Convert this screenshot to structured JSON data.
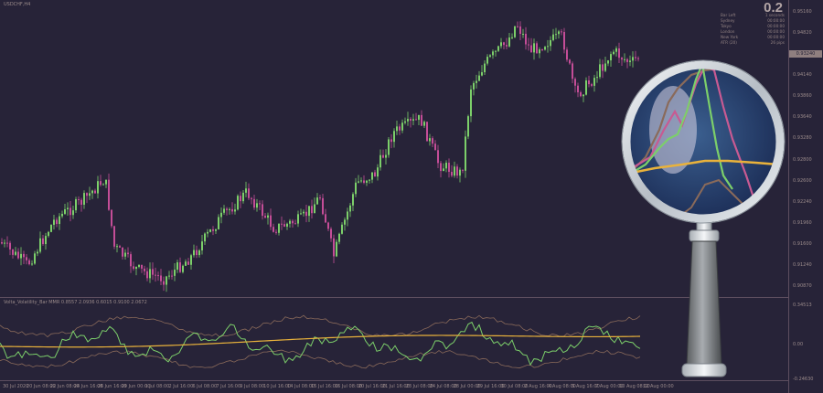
{
  "window": {
    "title": "USDCHF,H4",
    "indicator_label": "Volta_Volatility_Bar MMR 0.8557  2.0936  0.6015  0.9100  2.0672"
  },
  "info": {
    "big_value": "0.2",
    "rows": [
      {
        "label": "Bar Left",
        "value": "1 seconds"
      },
      {
        "label": "Sydney",
        "value": "00:00:00"
      },
      {
        "label": "Tokyo",
        "value": "00:00:00"
      },
      {
        "label": "London",
        "value": "00:00:00"
      },
      {
        "label": "New York",
        "value": "00:00:00"
      },
      {
        "label": "ATR (20)",
        "value": "26 pips"
      }
    ]
  },
  "price_axis": {
    "labels": [
      "0.95160",
      "0.94820",
      "0.94540",
      "0.94140",
      "0.93860",
      "0.93640",
      "0.93280",
      "0.92800",
      "0.92600",
      "0.92240",
      "0.91960",
      "0.91600",
      "0.91240",
      "0.90870"
    ],
    "current": "0.93240",
    "ind_labels": [
      "0.34513",
      "0.00",
      "-0.24630"
    ]
  },
  "time_axis": {
    "labels": [
      "30 Jul 2020",
      "20 Jun 08:00",
      "22 Jun 08:00",
      "24 Jun 16:00",
      "26 Jun 16:00",
      "29 Jun 00:00",
      "1 Jul 08:00",
      "2 Jul 16:00",
      "6 Jul 08:00",
      "7 Jul 16:00",
      "9 Jul 08:00",
      "10 Jul 16:00",
      "14 Jul 08:00",
      "15 Jul 16:00",
      "16 Jul 08:00",
      "20 Jul 16:00",
      "21 Jul 16:00",
      "23 Jul 08:00",
      "24 Jul 08:00",
      "28 Jul 00:00",
      "29 Jul 16:00",
      "30 Jul 08:00",
      "2 Aug 16:00",
      "4 Aug 08:00",
      "5 Aug 16:00",
      "7 Aug 00:00",
      "10 Aug 08:00",
      "12 Aug 00:00"
    ]
  },
  "colors": {
    "background": "#272338",
    "bull": "#7ccf6a",
    "bear": "#c44d97",
    "grid": "#5d4e5f",
    "osc_green": "#7ccf6a",
    "osc_brown": "#8a6a5a",
    "osc_yellow": "#e9b23b",
    "lens_pink": "#c85a92"
  },
  "icons": {
    "magnifier": "magnifying-glass-icon"
  }
}
